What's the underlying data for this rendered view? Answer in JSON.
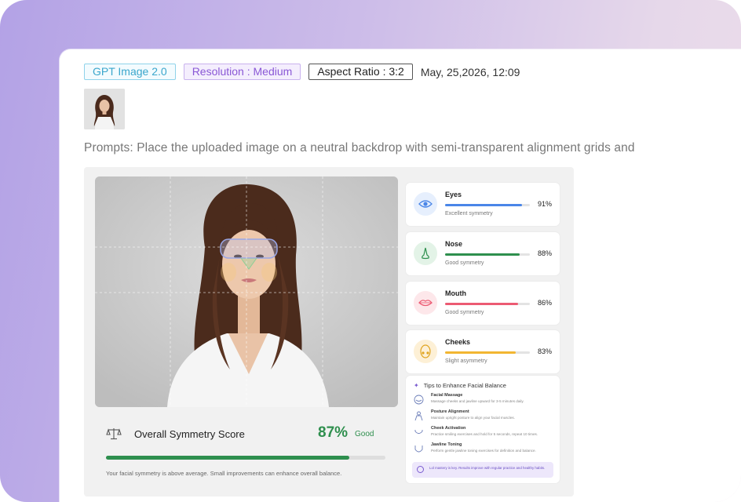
{
  "tags": {
    "model": "GPT Image 2.0",
    "resolution": "Resolution : Medium",
    "aspect_ratio": "Aspect Ratio : 3:2",
    "datetime": "May, 25,2026, 12:09"
  },
  "prompt": "Prompts: Place the uploaded image on a neutral backdrop with semi-transparent alignment grids and",
  "metrics": [
    {
      "name": "Eyes",
      "pct_label": "91%",
      "value": 91,
      "desc": "Excellent symmetry",
      "color": "#4a86e8",
      "icon": "eye-icon",
      "icon_bg": "#e6effd"
    },
    {
      "name": "Nose",
      "pct_label": "88%",
      "value": 88,
      "desc": "Good symmetry",
      "color": "#2e8f4e",
      "icon": "nose-icon",
      "icon_bg": "#e3f3e7"
    },
    {
      "name": "Mouth",
      "pct_label": "86%",
      "value": 86,
      "desc": "Good symmetry",
      "color": "#ec5b73",
      "icon": "lips-icon",
      "icon_bg": "#fde7ea"
    },
    {
      "name": "Cheeks",
      "pct_label": "83%",
      "value": 83,
      "desc": "Slight asymmetry",
      "color": "#f2b632",
      "icon": "cheek-icon",
      "icon_bg": "#fdf0d6"
    }
  ],
  "overall": {
    "title": "Overall Symmetry Score",
    "pct_label": "87%",
    "value": 87,
    "rating": "Good",
    "note": "Your facial symmetry is above average. Small improvements can enhance overall balance.",
    "icon": "balance-scale-icon"
  },
  "tips": {
    "title": "Tips to Enhance Facial Balance",
    "items": [
      {
        "name": "Facial Massage",
        "desc": "Massage cheeks and jawline upward for 3-5 minutes daily."
      },
      {
        "name": "Posture Alignment",
        "desc": "Maintain upright posture to align your facial muscles."
      },
      {
        "name": "Cheek Activation",
        "desc": "Practice smiling exercises and hold for 5 seconds, repeat 10 times."
      },
      {
        "name": "Jawline Toning",
        "desc": "Perform gentle jawline toning exercises for definition and balance."
      }
    ],
    "footer": "Lol mastery is key. Results improve with regular practice and healthy habits."
  },
  "colors": {
    "score_green": "#2f8f4e",
    "accent_purple": "#8a58d6",
    "accent_blue": "#3aa6cc"
  }
}
